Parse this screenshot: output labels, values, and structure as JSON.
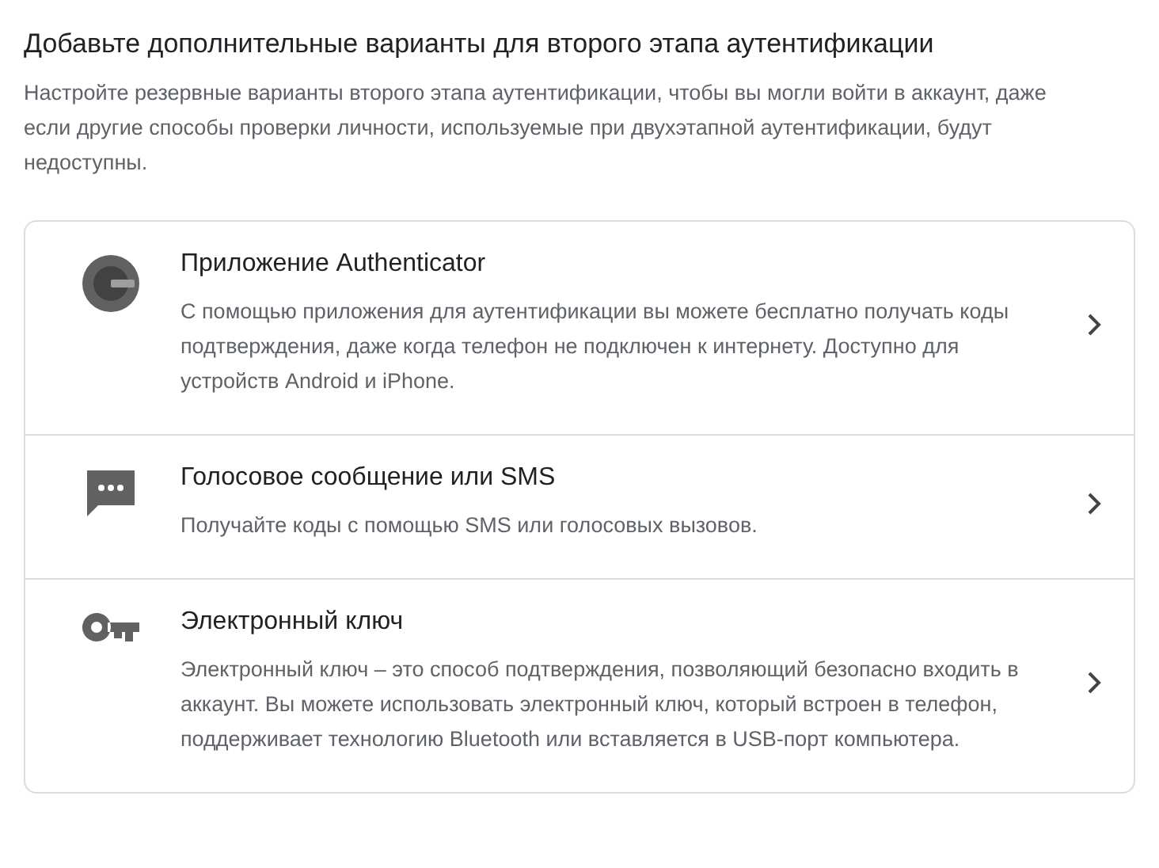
{
  "title": "Добавьте дополнительные варианты для второго этапа аутентификации",
  "description": "Настройте резервные варианты второго этапа аутентификации, чтобы вы могли войти в аккаунт, даже если другие способы проверки личности, используемые при двухэтапной аутентификации, будут недоступны.",
  "options": [
    {
      "kind": "authenticator",
      "title": "Приложение Authenticator",
      "description": "С помощью приложения для аутентификации вы можете бесплатно получать коды подтверждения, даже когда телефон не подключен к интернету. Доступно для устройств Android и iPhone."
    },
    {
      "kind": "sms",
      "title": "Голосовое сообщение или SMS",
      "description": "Получайте коды с помощью SMS или голосовых вызовов."
    },
    {
      "kind": "key",
      "title": "Электронный ключ",
      "description": "Электронный ключ – это способ подтверждения, позволяющий безопасно входить в аккаунт. Вы можете использовать электронный ключ, который встроен в телефон, поддерживает технологию Bluetooth или вставляется в USB-порт компьютера."
    }
  ]
}
